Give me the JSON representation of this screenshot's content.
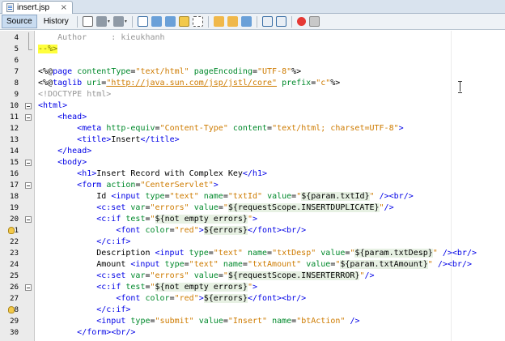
{
  "file_tab": {
    "label": "insert.jsp",
    "close_glyph": "×"
  },
  "view_tabs": [
    {
      "label": "Source",
      "active": true
    },
    {
      "label": "History",
      "active": false
    }
  ],
  "toolbar_icons": [
    "last-edit-icon",
    "back-icon",
    "forward-icon",
    "find-selection-icon",
    "find-previous-icon",
    "find-next-icon",
    "toggle-highlight-icon",
    "rectangular-selection-icon",
    "shift-left-icon",
    "shift-right-icon",
    "toggle-comment-icon",
    "previous-bookmark-icon",
    "next-bookmark-icon",
    "start-macro-icon",
    "stop-macro-icon"
  ],
  "colors": {
    "tag": "#0000e6",
    "attr": "#00892b",
    "value": "#ce7b00",
    "comment": "#969696",
    "highlight": "#ffff3d"
  },
  "lines": [
    {
      "n": "4",
      "fold": "guide",
      "tokens": [
        [
          "com",
          "    Author     : kieukhanh"
        ]
      ]
    },
    {
      "n": "5",
      "fold": "end",
      "tokens": [
        [
          "hl",
          "--%>"
        ]
      ]
    },
    {
      "n": "6",
      "tokens": []
    },
    {
      "n": "7",
      "tokens": [
        [
          "dir",
          "<%@"
        ],
        [
          "tag",
          "page"
        ],
        [
          "dir",
          " "
        ],
        [
          "attr",
          "contentType"
        ],
        [
          "dir",
          "="
        ],
        [
          "val",
          "\"text/html\""
        ],
        [
          "dir",
          " "
        ],
        [
          "attr",
          "pageEncoding"
        ],
        [
          "dir",
          "="
        ],
        [
          "val",
          "\"UTF-8\""
        ],
        [
          "dir",
          "%>"
        ]
      ]
    },
    {
      "n": "8",
      "tokens": [
        [
          "dir",
          "<%@"
        ],
        [
          "tag",
          "taglib"
        ],
        [
          "dir",
          " "
        ],
        [
          "attr",
          "uri"
        ],
        [
          "dir",
          "="
        ],
        [
          "link",
          "\"http://java.sun.com/jsp/jstl/core\""
        ],
        [
          "dir",
          " "
        ],
        [
          "attr",
          "prefix"
        ],
        [
          "dir",
          "="
        ],
        [
          "val",
          "\"c\""
        ],
        [
          "dir",
          "%>"
        ]
      ]
    },
    {
      "n": "9",
      "tokens": [
        [
          "com",
          "<!DOCTYPE html>"
        ]
      ]
    },
    {
      "n": "10",
      "fold": "box",
      "tokens": [
        [
          "tag",
          "<html>"
        ]
      ]
    },
    {
      "n": "11",
      "fold": "box",
      "tokens": [
        [
          "dir",
          "    "
        ],
        [
          "tag",
          "<head>"
        ]
      ]
    },
    {
      "n": "12",
      "tokens": [
        [
          "dir",
          "        "
        ],
        [
          "tag",
          "<meta"
        ],
        [
          "dir",
          " "
        ],
        [
          "attr",
          "http-equiv"
        ],
        [
          "dir",
          "="
        ],
        [
          "val",
          "\"Content-Type\""
        ],
        [
          "dir",
          " "
        ],
        [
          "attr",
          "content"
        ],
        [
          "dir",
          "="
        ],
        [
          "val",
          "\"text/html; charset=UTF-8\""
        ],
        [
          "tag",
          ">"
        ]
      ]
    },
    {
      "n": "13",
      "tokens": [
        [
          "dir",
          "        "
        ],
        [
          "tag",
          "<title>"
        ],
        [
          "dir",
          "Insert"
        ],
        [
          "tag",
          "</title>"
        ]
      ]
    },
    {
      "n": "14",
      "tokens": [
        [
          "dir",
          "    "
        ],
        [
          "tag",
          "</head>"
        ]
      ]
    },
    {
      "n": "15",
      "fold": "box",
      "tokens": [
        [
          "dir",
          "    "
        ],
        [
          "tag",
          "<body>"
        ]
      ]
    },
    {
      "n": "16",
      "tokens": [
        [
          "dir",
          "        "
        ],
        [
          "tag",
          "<h1>"
        ],
        [
          "dir",
          "Insert Record with Complex Key"
        ],
        [
          "tag",
          "</h1>"
        ]
      ]
    },
    {
      "n": "17",
      "fold": "box",
      "tokens": [
        [
          "dir",
          "        "
        ],
        [
          "tag",
          "<form"
        ],
        [
          "dir",
          " "
        ],
        [
          "attr",
          "action"
        ],
        [
          "dir",
          "="
        ],
        [
          "val",
          "\"CenterServlet\""
        ],
        [
          "tag",
          ">"
        ]
      ]
    },
    {
      "n": "18",
      "tokens": [
        [
          "dir",
          "            Id "
        ],
        [
          "tag",
          "<input"
        ],
        [
          "dir",
          " "
        ],
        [
          "attr",
          "type"
        ],
        [
          "dir",
          "="
        ],
        [
          "val",
          "\"text\""
        ],
        [
          "dir",
          " "
        ],
        [
          "attr",
          "name"
        ],
        [
          "dir",
          "="
        ],
        [
          "val",
          "\"txtId\""
        ],
        [
          "dir",
          " "
        ],
        [
          "attr",
          "value"
        ],
        [
          "dir",
          "="
        ],
        [
          "val",
          "\""
        ],
        [
          "el",
          "${param.txtId}"
        ],
        [
          "val",
          "\""
        ],
        [
          "dir",
          " "
        ],
        [
          "tag",
          "/><br/>"
        ]
      ]
    },
    {
      "n": "19",
      "tokens": [
        [
          "dir",
          "            "
        ],
        [
          "tag",
          "<c:set"
        ],
        [
          "dir",
          " "
        ],
        [
          "attr",
          "var"
        ],
        [
          "dir",
          "="
        ],
        [
          "val",
          "\"errors\""
        ],
        [
          "dir",
          " "
        ],
        [
          "attr",
          "value"
        ],
        [
          "dir",
          "="
        ],
        [
          "val",
          "\""
        ],
        [
          "el",
          "${requestScope.INSERTDUPLICATE}"
        ],
        [
          "val",
          "\""
        ],
        [
          "tag",
          "/>"
        ]
      ]
    },
    {
      "n": "20",
      "fold": "box",
      "tokens": [
        [
          "dir",
          "            "
        ],
        [
          "tag",
          "<c:if"
        ],
        [
          "dir",
          " "
        ],
        [
          "attr",
          "test"
        ],
        [
          "dir",
          "="
        ],
        [
          "val",
          "\""
        ],
        [
          "el",
          "${not empty errors}"
        ],
        [
          "val",
          "\""
        ],
        [
          "tag",
          ">"
        ]
      ]
    },
    {
      "n": "21",
      "bulb": true,
      "tokens": [
        [
          "dir",
          "                "
        ],
        [
          "tag",
          "<font"
        ],
        [
          "dir",
          " "
        ],
        [
          "attr",
          "color"
        ],
        [
          "dir",
          "="
        ],
        [
          "val",
          "\"red\""
        ],
        [
          "tag",
          ">"
        ],
        [
          "el",
          "${errors}"
        ],
        [
          "tag",
          "</font><br/>"
        ]
      ]
    },
    {
      "n": "22",
      "tokens": [
        [
          "dir",
          "            "
        ],
        [
          "tag",
          "</c:if>"
        ]
      ]
    },
    {
      "n": "23",
      "tokens": [
        [
          "dir",
          "            Description "
        ],
        [
          "tag",
          "<input"
        ],
        [
          "dir",
          " "
        ],
        [
          "attr",
          "type"
        ],
        [
          "dir",
          "="
        ],
        [
          "val",
          "\"text\""
        ],
        [
          "dir",
          " "
        ],
        [
          "attr",
          "name"
        ],
        [
          "dir",
          "="
        ],
        [
          "val",
          "\"txtDesp\""
        ],
        [
          "dir",
          " "
        ],
        [
          "attr",
          "value"
        ],
        [
          "dir",
          "="
        ],
        [
          "val",
          "\""
        ],
        [
          "el",
          "${param.txtDesp}"
        ],
        [
          "val",
          "\""
        ],
        [
          "dir",
          " "
        ],
        [
          "tag",
          "/><br/>"
        ]
      ]
    },
    {
      "n": "24",
      "tokens": [
        [
          "dir",
          "            Amount "
        ],
        [
          "tag",
          "<input"
        ],
        [
          "dir",
          " "
        ],
        [
          "attr",
          "type"
        ],
        [
          "dir",
          "="
        ],
        [
          "val",
          "\"text\""
        ],
        [
          "dir",
          " "
        ],
        [
          "attr",
          "name"
        ],
        [
          "dir",
          "="
        ],
        [
          "val",
          "\"txtAmount\""
        ],
        [
          "dir",
          " "
        ],
        [
          "attr",
          "value"
        ],
        [
          "dir",
          "="
        ],
        [
          "val",
          "\""
        ],
        [
          "el",
          "${param.txtAmount}"
        ],
        [
          "val",
          "\""
        ],
        [
          "dir",
          " "
        ],
        [
          "tag",
          "/><br/>"
        ]
      ]
    },
    {
      "n": "25",
      "tokens": [
        [
          "dir",
          "            "
        ],
        [
          "tag",
          "<c:set"
        ],
        [
          "dir",
          " "
        ],
        [
          "attr",
          "var"
        ],
        [
          "dir",
          "="
        ],
        [
          "val",
          "\"errors\""
        ],
        [
          "dir",
          " "
        ],
        [
          "attr",
          "value"
        ],
        [
          "dir",
          "="
        ],
        [
          "val",
          "\""
        ],
        [
          "el",
          "${requestScope.INSERTERROR}"
        ],
        [
          "val",
          "\""
        ],
        [
          "tag",
          "/>"
        ]
      ]
    },
    {
      "n": "26",
      "fold": "box",
      "tokens": [
        [
          "dir",
          "            "
        ],
        [
          "tag",
          "<c:if"
        ],
        [
          "dir",
          " "
        ],
        [
          "attr",
          "test"
        ],
        [
          "dir",
          "="
        ],
        [
          "val",
          "\""
        ],
        [
          "el",
          "${not empty errors}"
        ],
        [
          "val",
          "\""
        ],
        [
          "tag",
          ">"
        ]
      ]
    },
    {
      "n": "27",
      "tokens": [
        [
          "dir",
          "                "
        ],
        [
          "tag",
          "<font"
        ],
        [
          "dir",
          " "
        ],
        [
          "attr",
          "color"
        ],
        [
          "dir",
          "="
        ],
        [
          "val",
          "\"red\""
        ],
        [
          "tag",
          ">"
        ],
        [
          "el",
          "${errors}"
        ],
        [
          "tag",
          "</font><br/>"
        ]
      ]
    },
    {
      "n": "28",
      "bulb": true,
      "tokens": [
        [
          "dir",
          "            "
        ],
        [
          "tag",
          "</c:if>"
        ]
      ]
    },
    {
      "n": "29",
      "tokens": [
        [
          "dir",
          "            "
        ],
        [
          "tag",
          "<input"
        ],
        [
          "dir",
          " "
        ],
        [
          "attr",
          "type"
        ],
        [
          "dir",
          "="
        ],
        [
          "val",
          "\"submit\""
        ],
        [
          "dir",
          " "
        ],
        [
          "attr",
          "value"
        ],
        [
          "dir",
          "="
        ],
        [
          "val",
          "\"Insert\""
        ],
        [
          "dir",
          " "
        ],
        [
          "attr",
          "name"
        ],
        [
          "dir",
          "="
        ],
        [
          "val",
          "\"btAction\""
        ],
        [
          "dir",
          " "
        ],
        [
          "tag",
          "/>"
        ]
      ]
    },
    {
      "n": "30",
      "tokens": [
        [
          "dir",
          "        "
        ],
        [
          "tag",
          "</form><br/>"
        ]
      ]
    }
  ]
}
